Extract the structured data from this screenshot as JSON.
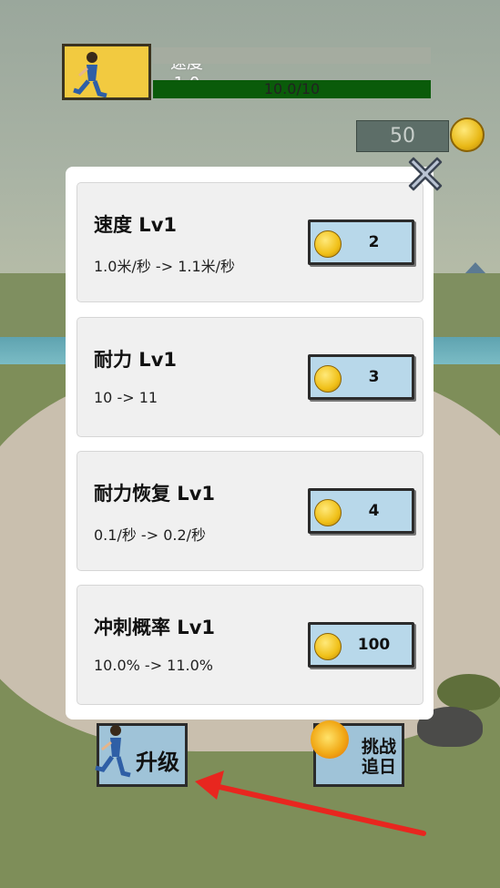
{
  "hud": {
    "speed_label": "速度",
    "speed_value": "1.0",
    "stamina_text": "10.0/10",
    "stamina_fraction": 1.0,
    "coins": "50"
  },
  "upgrades": [
    {
      "title": "速度 Lv1",
      "desc": "1.0米/秒 -> 1.1米/秒",
      "cost": "2"
    },
    {
      "title": "耐力 Lv1",
      "desc": "10 -> 11",
      "cost": "3"
    },
    {
      "title": "耐力恢复 Lv1",
      "desc": "0.1/秒 -> 0.2/秒",
      "cost": "4"
    },
    {
      "title": "冲刺概率 Lv1",
      "desc": "10.0% -> 11.0%",
      "cost": "100"
    }
  ],
  "bottom": {
    "upgrade_label": "升级",
    "challenge_line1": "挑战",
    "challenge_line2": "追日"
  },
  "colors": {
    "stamina_bar": "#0a5b0a",
    "buy_button": "#b8d8ea",
    "arrow": "#e8261f"
  }
}
